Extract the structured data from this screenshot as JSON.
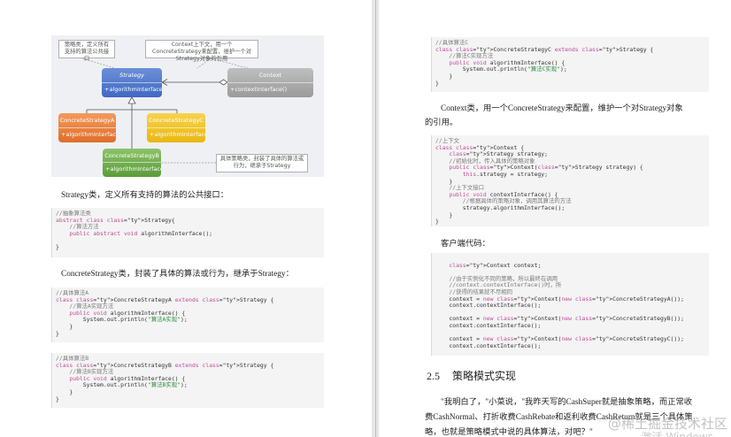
{
  "diagram": {
    "note_strategy": "策略类，定义所有支持的算法公共接口",
    "note_context": "Context上下文，用一个ConcreteStrategy来配置，维护一个对Strategy对象的引用",
    "note_concrete": "具体策略类，封装了具体的算法或行为，继承于Strategy",
    "strategy": {
      "name": "Strategy",
      "method": "+algorithmInterface()"
    },
    "context": {
      "name": "Context",
      "method": "+contextInterface()"
    },
    "concrete_a": {
      "name": "ConcreteStrategyA",
      "method": "+algorithmInterface()"
    },
    "concrete_b": {
      "name": "ConcreteStrategyB",
      "method": "+algorithmInterface()"
    },
    "concrete_c": {
      "name": "ConcreteStrategyC",
      "method": "+algorithmInterface()"
    }
  },
  "left": {
    "para_strategy": "Strategy类，定义所有支持的算法的公共接口：",
    "code_strategy": [
      {
        "c": "cm",
        "t": "//抽象算法类"
      },
      {
        "c": "pl",
        "t": "abstract class Strategy{"
      },
      {
        "c": "cm",
        "t": "    //算法方法"
      },
      {
        "c": "pl",
        "t": "    public abstract void algorithmInterface();"
      },
      {
        "c": "pl",
        "t": ""
      },
      {
        "c": "pl",
        "t": "}"
      }
    ],
    "para_concrete": "ConcreteStrategy类，封装了具体的算法或行为，继承于Strategy：",
    "code_a": [
      {
        "c": "cm",
        "t": "//具体算法A"
      },
      {
        "c": "pl",
        "t": "class ConcreteStrategyA extends Strategy {"
      },
      {
        "c": "cm",
        "t": "    //算法A实现方法"
      },
      {
        "c": "pl",
        "t": "    public void algorithmInterface() {"
      },
      {
        "c": "pl",
        "t": "        System.out.println(\"算法A实现\");"
      },
      {
        "c": "pl",
        "t": "    }"
      },
      {
        "c": "pl",
        "t": "}"
      }
    ],
    "code_b": [
      {
        "c": "cm",
        "t": "//具体算法B"
      },
      {
        "c": "pl",
        "t": "class ConcreteStrategyB extends Strategy {"
      },
      {
        "c": "cm",
        "t": "    //算法B实现方法"
      },
      {
        "c": "pl",
        "t": "    public void algorithmInterface() {"
      },
      {
        "c": "pl",
        "t": "        System.out.println(\"算法B实现\");"
      },
      {
        "c": "pl",
        "t": "    }"
      },
      {
        "c": "pl",
        "t": "}"
      }
    ]
  },
  "right": {
    "code_c": [
      {
        "c": "cm",
        "t": "//具体算法C"
      },
      {
        "c": "pl",
        "t": "class ConcreteStrategyC extends Strategy {"
      },
      {
        "c": "cm",
        "t": "    //算法C实现方法"
      },
      {
        "c": "pl",
        "t": "    public void algorithmInterface() {"
      },
      {
        "c": "pl",
        "t": "        System.out.println(\"算法C实现\");"
      },
      {
        "c": "pl",
        "t": "    }"
      },
      {
        "c": "pl",
        "t": "}"
      }
    ],
    "para_context": "Context类，用一个ConcreteStrategy来配置，维护一个对Strategy对象",
    "para_context_2": "的引用。",
    "code_context": [
      {
        "c": "cm",
        "t": "//上下文"
      },
      {
        "c": "pl",
        "t": "class Context {"
      },
      {
        "c": "pl",
        "t": "    Strategy strategy;"
      },
      {
        "c": "cm",
        "t": "    //初始化时，传入具体的策略对象"
      },
      {
        "c": "pl",
        "t": "    public Context(Strategy strategy) {"
      },
      {
        "c": "pl",
        "t": "        this.strategy = strategy;"
      },
      {
        "c": "pl",
        "t": "    }"
      },
      {
        "c": "cm",
        "t": "    //上下文接口"
      },
      {
        "c": "pl",
        "t": "    public void contextInterface() {"
      },
      {
        "c": "cm",
        "t": "        //根据具体的策略对象，调用其算法的方法"
      },
      {
        "c": "pl",
        "t": "        strategy.algorithmInterface();"
      },
      {
        "c": "pl",
        "t": "    }"
      },
      {
        "c": "pl",
        "t": "}"
      }
    ],
    "para_client": "客户端代码：",
    "code_client": [
      {
        "c": "pl",
        "t": ""
      },
      {
        "c": "pl",
        "t": "    Context context;"
      },
      {
        "c": "pl",
        "t": ""
      },
      {
        "c": "cm",
        "t": "    //由于实例化不同的策略，所以最终在调用"
      },
      {
        "c": "cm",
        "t": "    //context.contextInterface()时，所"
      },
      {
        "c": "cm",
        "t": "    //获得的结果就不尽相同"
      },
      {
        "c": "pl",
        "t": "    context = new Context(new ConcreteStrategyA());"
      },
      {
        "c": "pl",
        "t": "    context.contextInterface();"
      },
      {
        "c": "pl",
        "t": ""
      },
      {
        "c": "pl",
        "t": "    context = new Context(new ConcreteStrategyB());"
      },
      {
        "c": "pl",
        "t": "    context.contextInterface();"
      },
      {
        "c": "pl",
        "t": ""
      },
      {
        "c": "pl",
        "t": "    context = new Context(new ConcreteStrategyC());"
      },
      {
        "c": "pl",
        "t": "    context.contextInterface();"
      },
      {
        "c": "pl",
        "t": ""
      }
    ],
    "section_number": "2.5",
    "section_title": "策略模式实现",
    "body_1": "\"我明白了，\"小菜说，\"我昨天写的CashSuper就是抽象策略，而正常收",
    "body_2": "费CashNormal、打折收费CashRebate和返利收费CashReturn就是三个具体策",
    "body_3": "略，也就是策略模式中说的具体算法，对吧？\""
  },
  "watermark": "@稀土掘金技术社区",
  "watermark_2": "激活 Windows"
}
